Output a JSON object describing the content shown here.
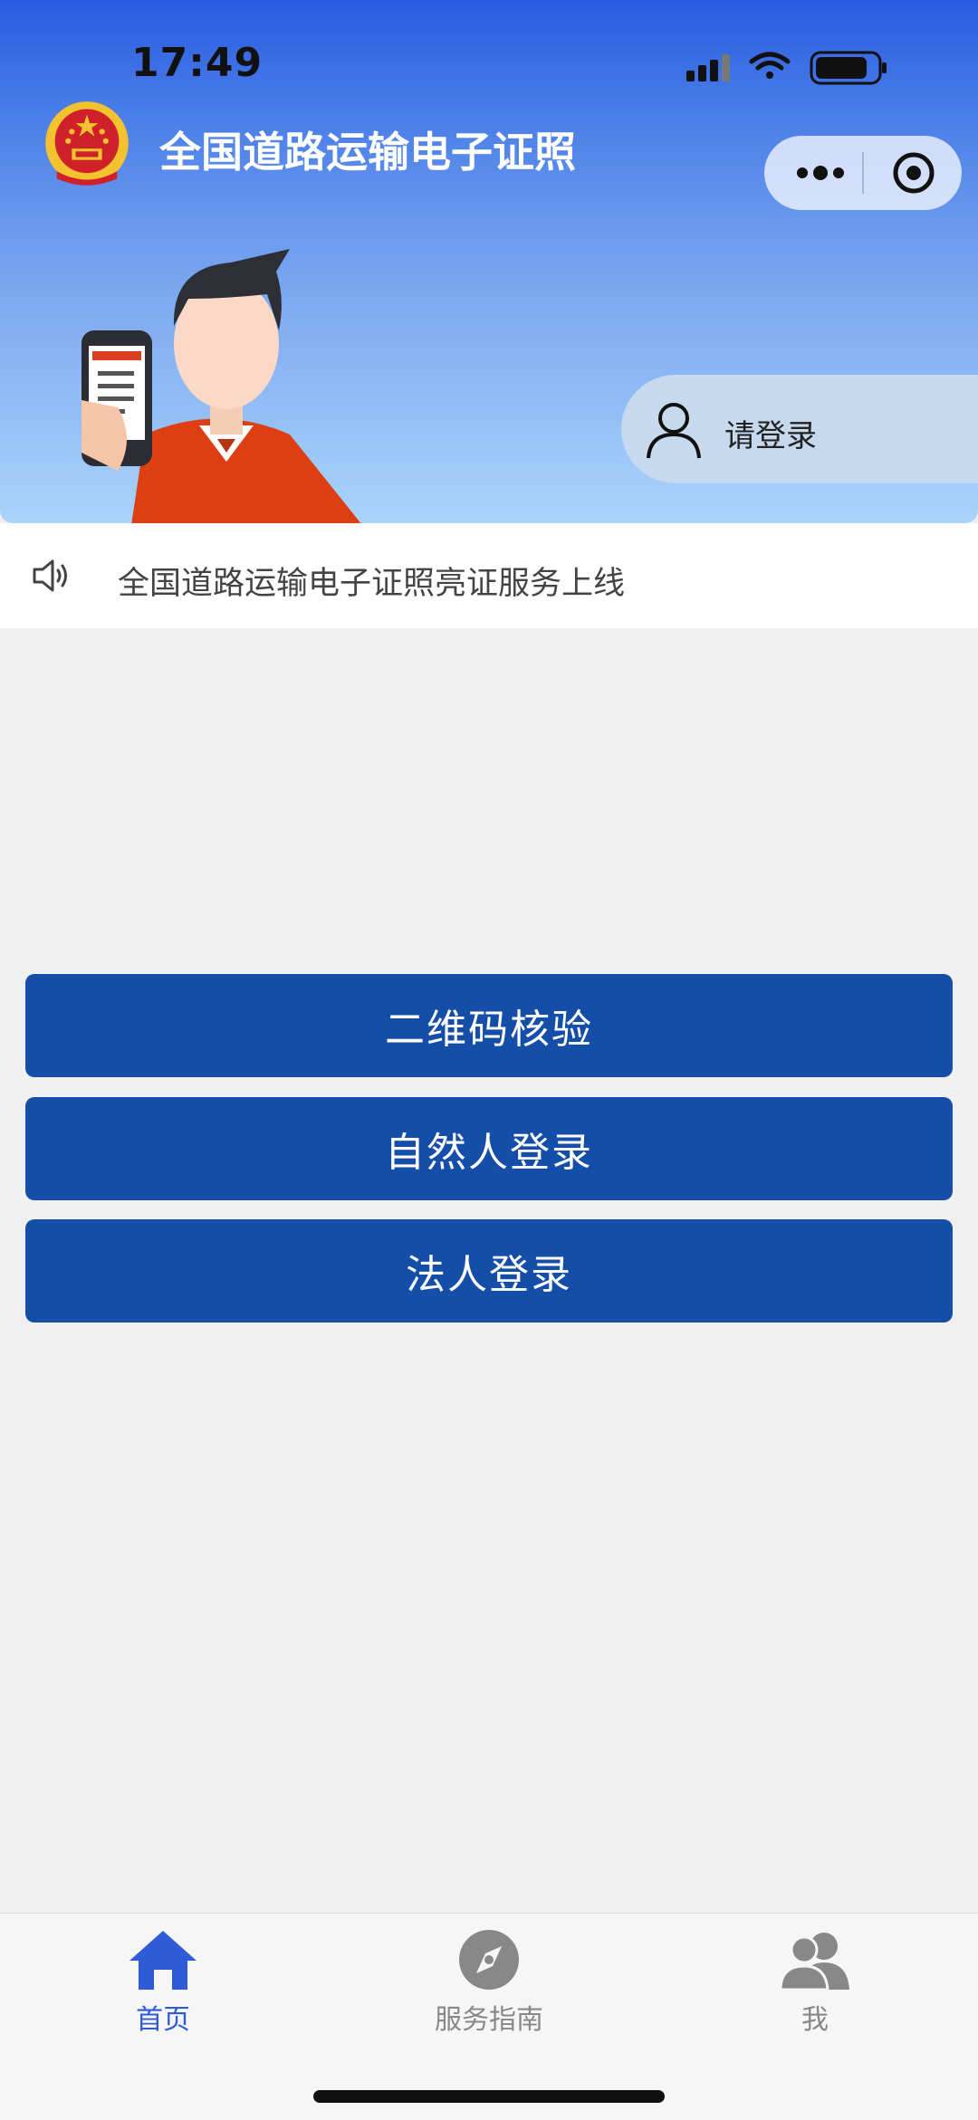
{
  "status_bar": {
    "time": "17:49"
  },
  "header": {
    "title": "全国道路运输电子证照",
    "login_label": "请登录"
  },
  "notice": {
    "text": "全国道路运输电子证照亮证服务上线"
  },
  "buttons": [
    {
      "label": "二维码核验"
    },
    {
      "label": "自然人登录"
    },
    {
      "label": "法人登录"
    }
  ],
  "tabbar": {
    "items": [
      {
        "label": "首页",
        "icon": "home-icon",
        "active": true
      },
      {
        "label": "服务指南",
        "icon": "compass-icon",
        "active": false
      },
      {
        "label": "我",
        "icon": "user-group-icon",
        "active": false
      }
    ]
  },
  "colors": {
    "accent": "#154ea8",
    "tab_active": "#2f5bd6",
    "tab_inactive": "#888888"
  }
}
